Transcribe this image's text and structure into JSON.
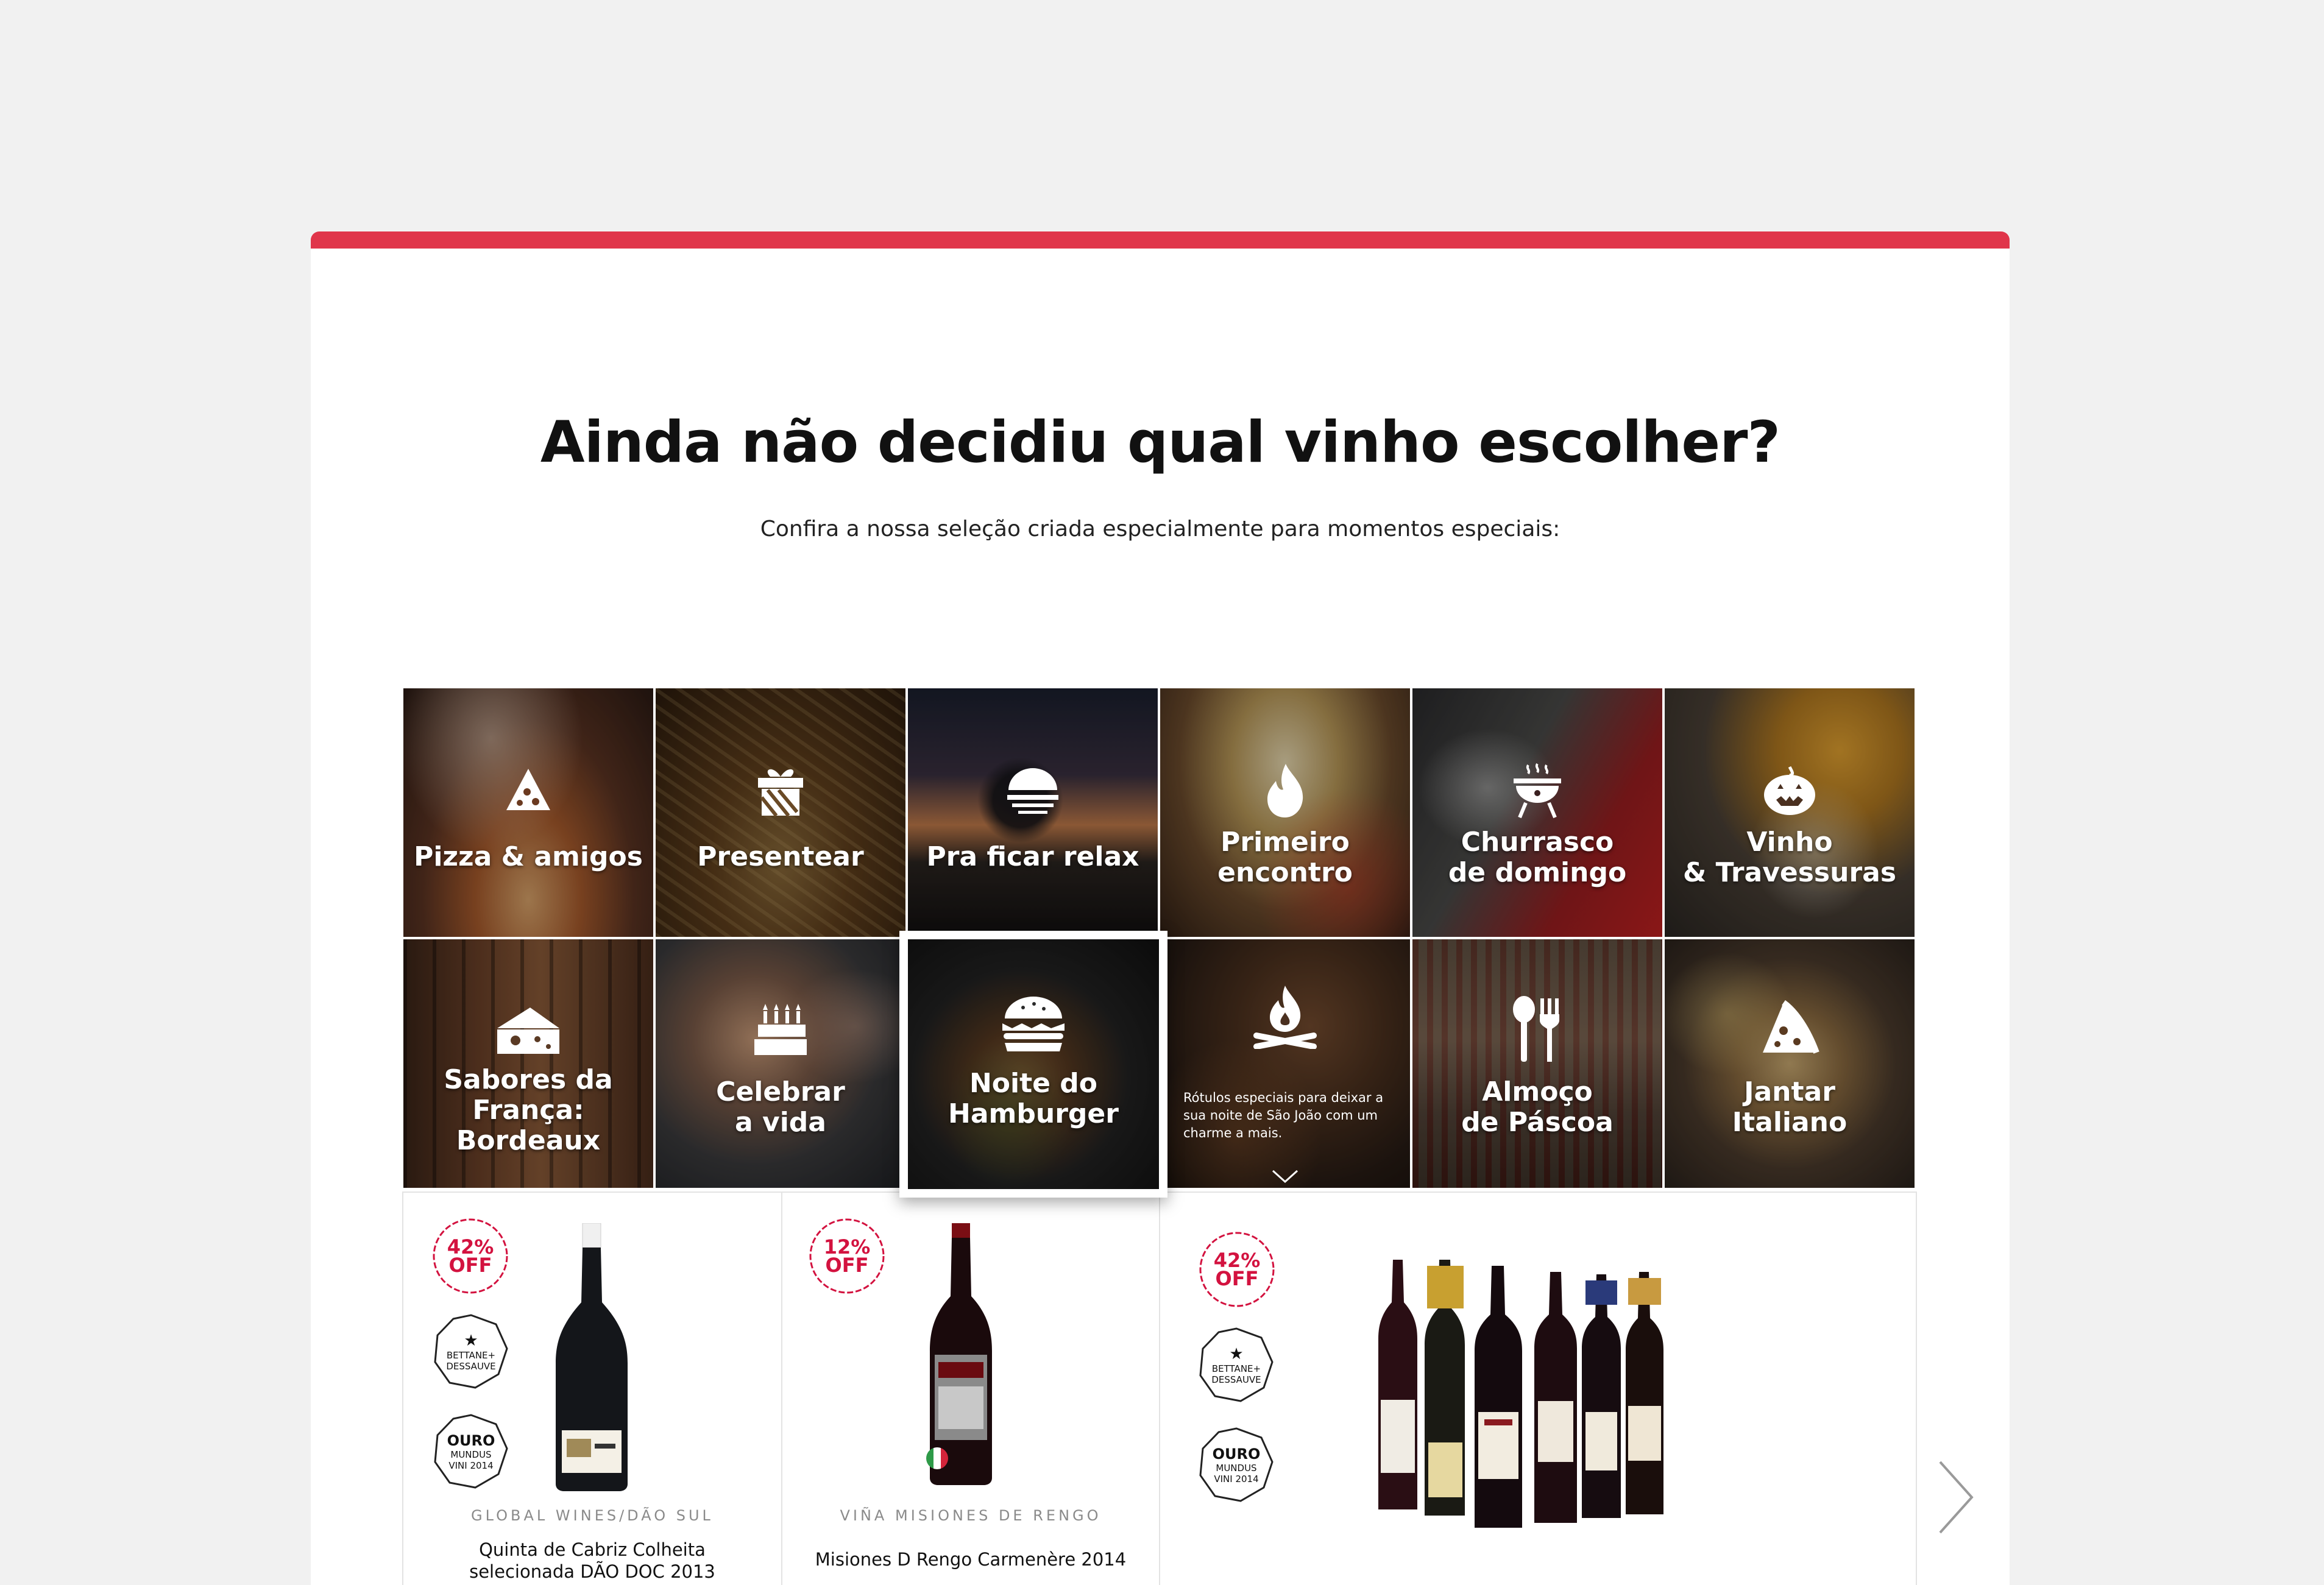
{
  "accent_color": "#e0354a",
  "badge_color": "#d3123f",
  "header": {
    "title": "Ainda não decidiu qual vinho escolher?",
    "subtitle": "Confira a nossa seleção criada especialmente para momentos especiais:"
  },
  "moments": [
    {
      "label": "Pizza & amigos",
      "icon": "pizza-slice-icon"
    },
    {
      "label": "Presentear",
      "icon": "gift-icon"
    },
    {
      "label": "Pra ficar relax",
      "icon": "burger-sunset-icon"
    },
    {
      "label": "Primeiro\nencontro",
      "icon": "flame-icon"
    },
    {
      "label": "Churrasco\nde domingo",
      "icon": "grill-icon"
    },
    {
      "label": "Vinho\n& Travessuras",
      "icon": "pumpkin-icon"
    },
    {
      "label": "Sabores da\nFrança:\nBordeaux",
      "icon": "cheese-icon"
    },
    {
      "label": "Celebrar\na vida",
      "icon": "cake-icon"
    },
    {
      "label": "Noite do\nHamburger",
      "icon": "burger-icon"
    },
    {
      "label": "",
      "icon": "campfire-icon",
      "description": "Rótulos especiais para deixar a sua noite de São João com um charme a mais."
    },
    {
      "label": "Almoço\nde Páscoa",
      "icon": "spoon-fork-icon"
    },
    {
      "label": "Jantar\nItaliano",
      "icon": "pizza-icon"
    }
  ],
  "products": [
    {
      "discount": [
        "42%",
        "OFF"
      ],
      "awards": [
        {
          "line1": "★",
          "line2": "BETTANE+",
          "line3": "DESSAUVE"
        },
        {
          "line1": "OURO",
          "line2": "MUNDUS",
          "line3": "VINI 2014"
        }
      ],
      "producer": "GLOBAL WINES/DÃO SUL",
      "name": "Quinta de Cabriz Colheita\nselecionada DÃO DOC 2013"
    },
    {
      "discount": [
        "12%",
        "OFF"
      ],
      "awards": [],
      "producer": "VIÑA MISIONES DE RENGO",
      "name": "Misiones D Rengo Carmenère 2014"
    },
    {
      "discount": [
        "42%",
        "OFF"
      ],
      "awards": [
        {
          "line1": "★",
          "line2": "BETTANE+",
          "line3": "DESSAUVE"
        },
        {
          "line1": "OURO",
          "line2": "MUNDUS",
          "line3": "VINI 2014"
        }
      ],
      "producer": "",
      "name": ""
    }
  ],
  "carousel": {
    "next_icon": "chevron-right-icon"
  }
}
